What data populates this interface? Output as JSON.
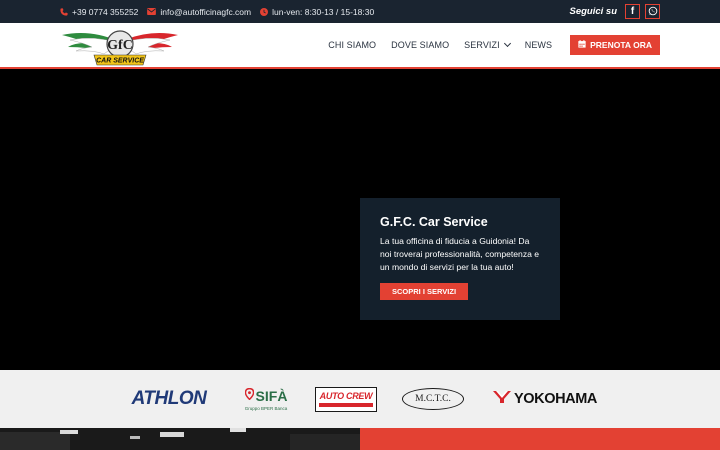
{
  "topbar": {
    "phone": "+39 0774 355252",
    "email": "info@autofficinagfc.com",
    "hours": "lun-ven: 8:30-13 / 15-18:30",
    "social_label": "Seguici su",
    "social_links": [
      {
        "label": "f",
        "icon": "facebook-icon"
      },
      {
        "label": "whatsapp",
        "icon": "whatsapp-icon"
      }
    ]
  },
  "header": {
    "logo_text": "CAR SERVICE",
    "logo_letters": "GfC",
    "nav": [
      {
        "label": "CHI SIAMO"
      },
      {
        "label": "DOVE SIAMO"
      },
      {
        "label": "SERVIZI",
        "has_dropdown": true
      },
      {
        "label": "NEWS"
      }
    ],
    "cta": "PRENOTA ORA"
  },
  "hero": {
    "title": "G.F.C. Car Service",
    "text": "La tua officina di fiducia a Guidonia! Da noi troverai professionalità, competenza e un mondo di servizi per la tua auto!",
    "button": "SCOPRI I SERVIZI"
  },
  "brands": {
    "athlon": "ATHLON",
    "sifa": "SIFÀ",
    "sifa_sub": "Gruppo BPER Banca",
    "autocrew": "AUTO CREW",
    "mctc": "M.C.T.C.",
    "yokohama": "YOKOHAMA"
  },
  "colors": {
    "accent": "#e34133",
    "topbar_bg": "#1a2430",
    "card_bg": "#14202c"
  }
}
